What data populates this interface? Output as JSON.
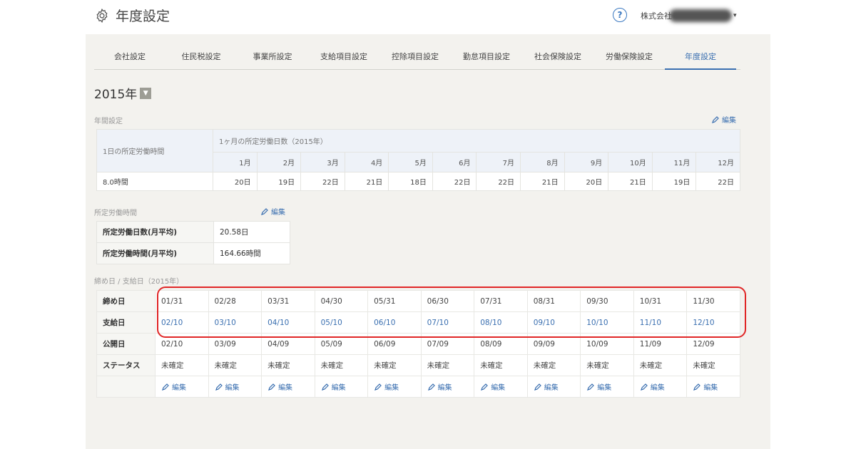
{
  "header": {
    "title": "年度設定",
    "help_label": "?",
    "company": "株式会社"
  },
  "tabs": [
    "会社設定",
    "住民税設定",
    "事業所設定",
    "支給項目設定",
    "控除項目設定",
    "勤怠項目設定",
    "社会保険設定",
    "労働保険設定",
    "年度設定"
  ],
  "active_tab": 8,
  "year": {
    "label": "2015年",
    "dropdown_icon": "chevron-down-icon"
  },
  "annual": {
    "section_label": "年間設定",
    "edit_label": "編集",
    "hours_header": "1日の所定労働時間",
    "days_header": "1ヶ月の所定労働日数（2015年）",
    "months": [
      "1月",
      "2月",
      "3月",
      "4月",
      "5月",
      "6月",
      "7月",
      "8月",
      "9月",
      "10月",
      "11月",
      "12月"
    ],
    "hours_value": "8.0時間",
    "days": [
      "20日",
      "19日",
      "22日",
      "21日",
      "18日",
      "22日",
      "22日",
      "21日",
      "20日",
      "21日",
      "19日",
      "22日"
    ]
  },
  "scheduled": {
    "section_label": "所定労働時間",
    "edit_label": "編集",
    "rows": [
      {
        "label": "所定労働日数(月平均)",
        "value": "20.58日"
      },
      {
        "label": "所定労働時間(月平均)",
        "value": "164.66時間"
      }
    ]
  },
  "closing": {
    "section_label": "締め日 / 支給日（2015年）",
    "closing_label": "締め日",
    "closing": [
      "01/31",
      "02/28",
      "03/31",
      "04/30",
      "05/31",
      "06/30",
      "07/31",
      "08/31",
      "09/30",
      "10/31",
      "11/30"
    ],
    "pay_label": "支給日",
    "pay": [
      "02/10",
      "03/10",
      "04/10",
      "05/10",
      "06/10",
      "07/10",
      "08/10",
      "09/10",
      "10/10",
      "11/10",
      "12/10"
    ],
    "publish_label": "公開日",
    "publish": [
      "02/10",
      "03/09",
      "04/09",
      "05/09",
      "06/09",
      "07/09",
      "08/09",
      "09/09",
      "10/09",
      "11/09",
      "12/09"
    ],
    "status_label": "ステータス",
    "status": [
      "未確定",
      "未確定",
      "未確定",
      "未確定",
      "未確定",
      "未確定",
      "未確定",
      "未確定",
      "未確定",
      "未確定",
      "未確定"
    ],
    "edit_label": "編集"
  },
  "colors": {
    "accent": "#3a6fb0",
    "highlight": "#e02626",
    "panel": "#f3f2ee"
  }
}
